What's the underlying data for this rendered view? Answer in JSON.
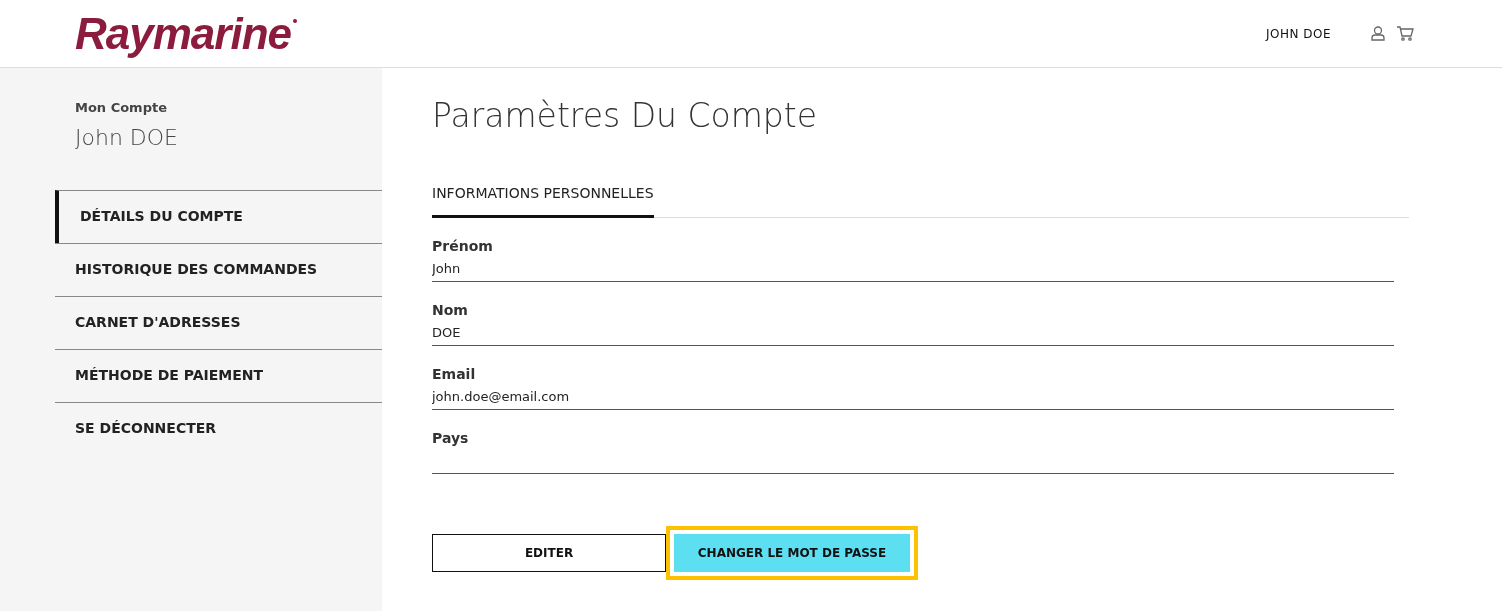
{
  "header": {
    "logo": "Raymarine",
    "user_name": "JOHN DOE"
  },
  "sidebar": {
    "caption": "Mon Compte",
    "name": "John DOE",
    "items": [
      {
        "label": "DÉTAILS DU COMPTE",
        "selected": true
      },
      {
        "label": "HISTORIQUE DES COMMANDES",
        "selected": false
      },
      {
        "label": "CARNET D'ADRESSES",
        "selected": false
      },
      {
        "label": "MÉTHODE DE PAIEMENT",
        "selected": false
      },
      {
        "label": "SE DÉCONNECTER",
        "selected": false
      }
    ]
  },
  "main": {
    "title": "Paramètres Du Compte",
    "tabs": [
      {
        "label": "INFORMATIONS PERSONNELLES",
        "selected": true
      }
    ],
    "fields": [
      {
        "label": "Prénom",
        "value": "John"
      },
      {
        "label": "Nom",
        "value": "DOE"
      },
      {
        "label": "Email",
        "value": "john.doe@email.com"
      },
      {
        "label": "Pays"
      }
    ],
    "buttons": [
      {
        "label": "EDITER",
        "kind": "outline",
        "highlighted": false
      },
      {
        "label": "CHANGER LE MOT DE PASSE",
        "kind": "primary",
        "highlighted": true
      }
    ]
  }
}
